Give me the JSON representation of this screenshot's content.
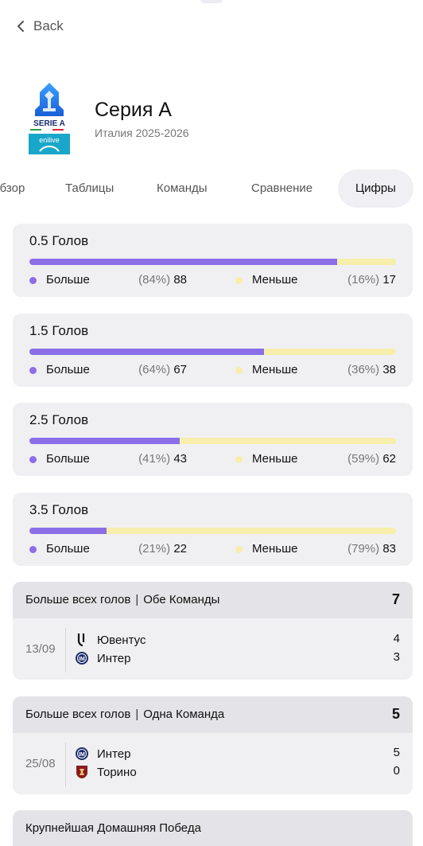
{
  "nav": {
    "back_label": "Back"
  },
  "league": {
    "name": "Серия А",
    "subtitle": "Италия 2025-2026",
    "logo_text": {
      "line1": "SERIE A",
      "line2": "enilive"
    }
  },
  "tabs": [
    {
      "label": "Обзор",
      "active": false
    },
    {
      "label": "Таблицы",
      "active": false
    },
    {
      "label": "Команды",
      "active": false
    },
    {
      "label": "Сравнение",
      "active": false
    },
    {
      "label": "Цифры",
      "active": true
    }
  ],
  "colors": {
    "over": "#8b6ee8",
    "under": "#f6eeaa",
    "card": "#f0f0f2",
    "header": "#e4e4e8"
  },
  "goals": [
    {
      "title": "0.5 Голов",
      "over_label": "Больше",
      "over_pct": "(84%)",
      "over_count": "88",
      "under_label": "Меньше",
      "under_pct": "(16%)",
      "under_count": "17",
      "over_fraction": 0.84
    },
    {
      "title": "1.5 Голов",
      "over_label": "Больше",
      "over_pct": "(64%)",
      "over_count": "67",
      "under_label": "Меньше",
      "under_pct": "(36%)",
      "under_count": "38",
      "over_fraction": 0.64
    },
    {
      "title": "2.5 Голов",
      "over_label": "Больше",
      "over_pct": "(41%)",
      "over_count": "43",
      "under_label": "Меньше",
      "under_pct": "(59%)",
      "under_count": "62",
      "over_fraction": 0.41
    },
    {
      "title": "3.5 Голов",
      "over_label": "Больше",
      "over_pct": "(21%)",
      "over_count": "22",
      "under_label": "Меньше",
      "under_pct": "(79%)",
      "under_count": "83",
      "over_fraction": 0.21
    }
  ],
  "records": [
    {
      "title": "Больше всех голов",
      "separator": "|",
      "qualifier": "Обе Команды",
      "total": "7",
      "date": "13/09",
      "teams": [
        {
          "name": "Ювентус",
          "score": "4",
          "icon": "juventus-crest-icon"
        },
        {
          "name": "Интер",
          "score": "3",
          "icon": "inter-crest-icon"
        }
      ]
    },
    {
      "title": "Больше всех голов",
      "separator": "|",
      "qualifier": "Одна Команда",
      "total": "5",
      "date": "25/08",
      "teams": [
        {
          "name": "Интер",
          "score": "5",
          "icon": "inter-crest-icon"
        },
        {
          "name": "Торино",
          "score": "0",
          "icon": "torino-crest-icon"
        }
      ]
    }
  ],
  "bottom_section": {
    "title": "Крупнейшая Домашняя Победа"
  }
}
